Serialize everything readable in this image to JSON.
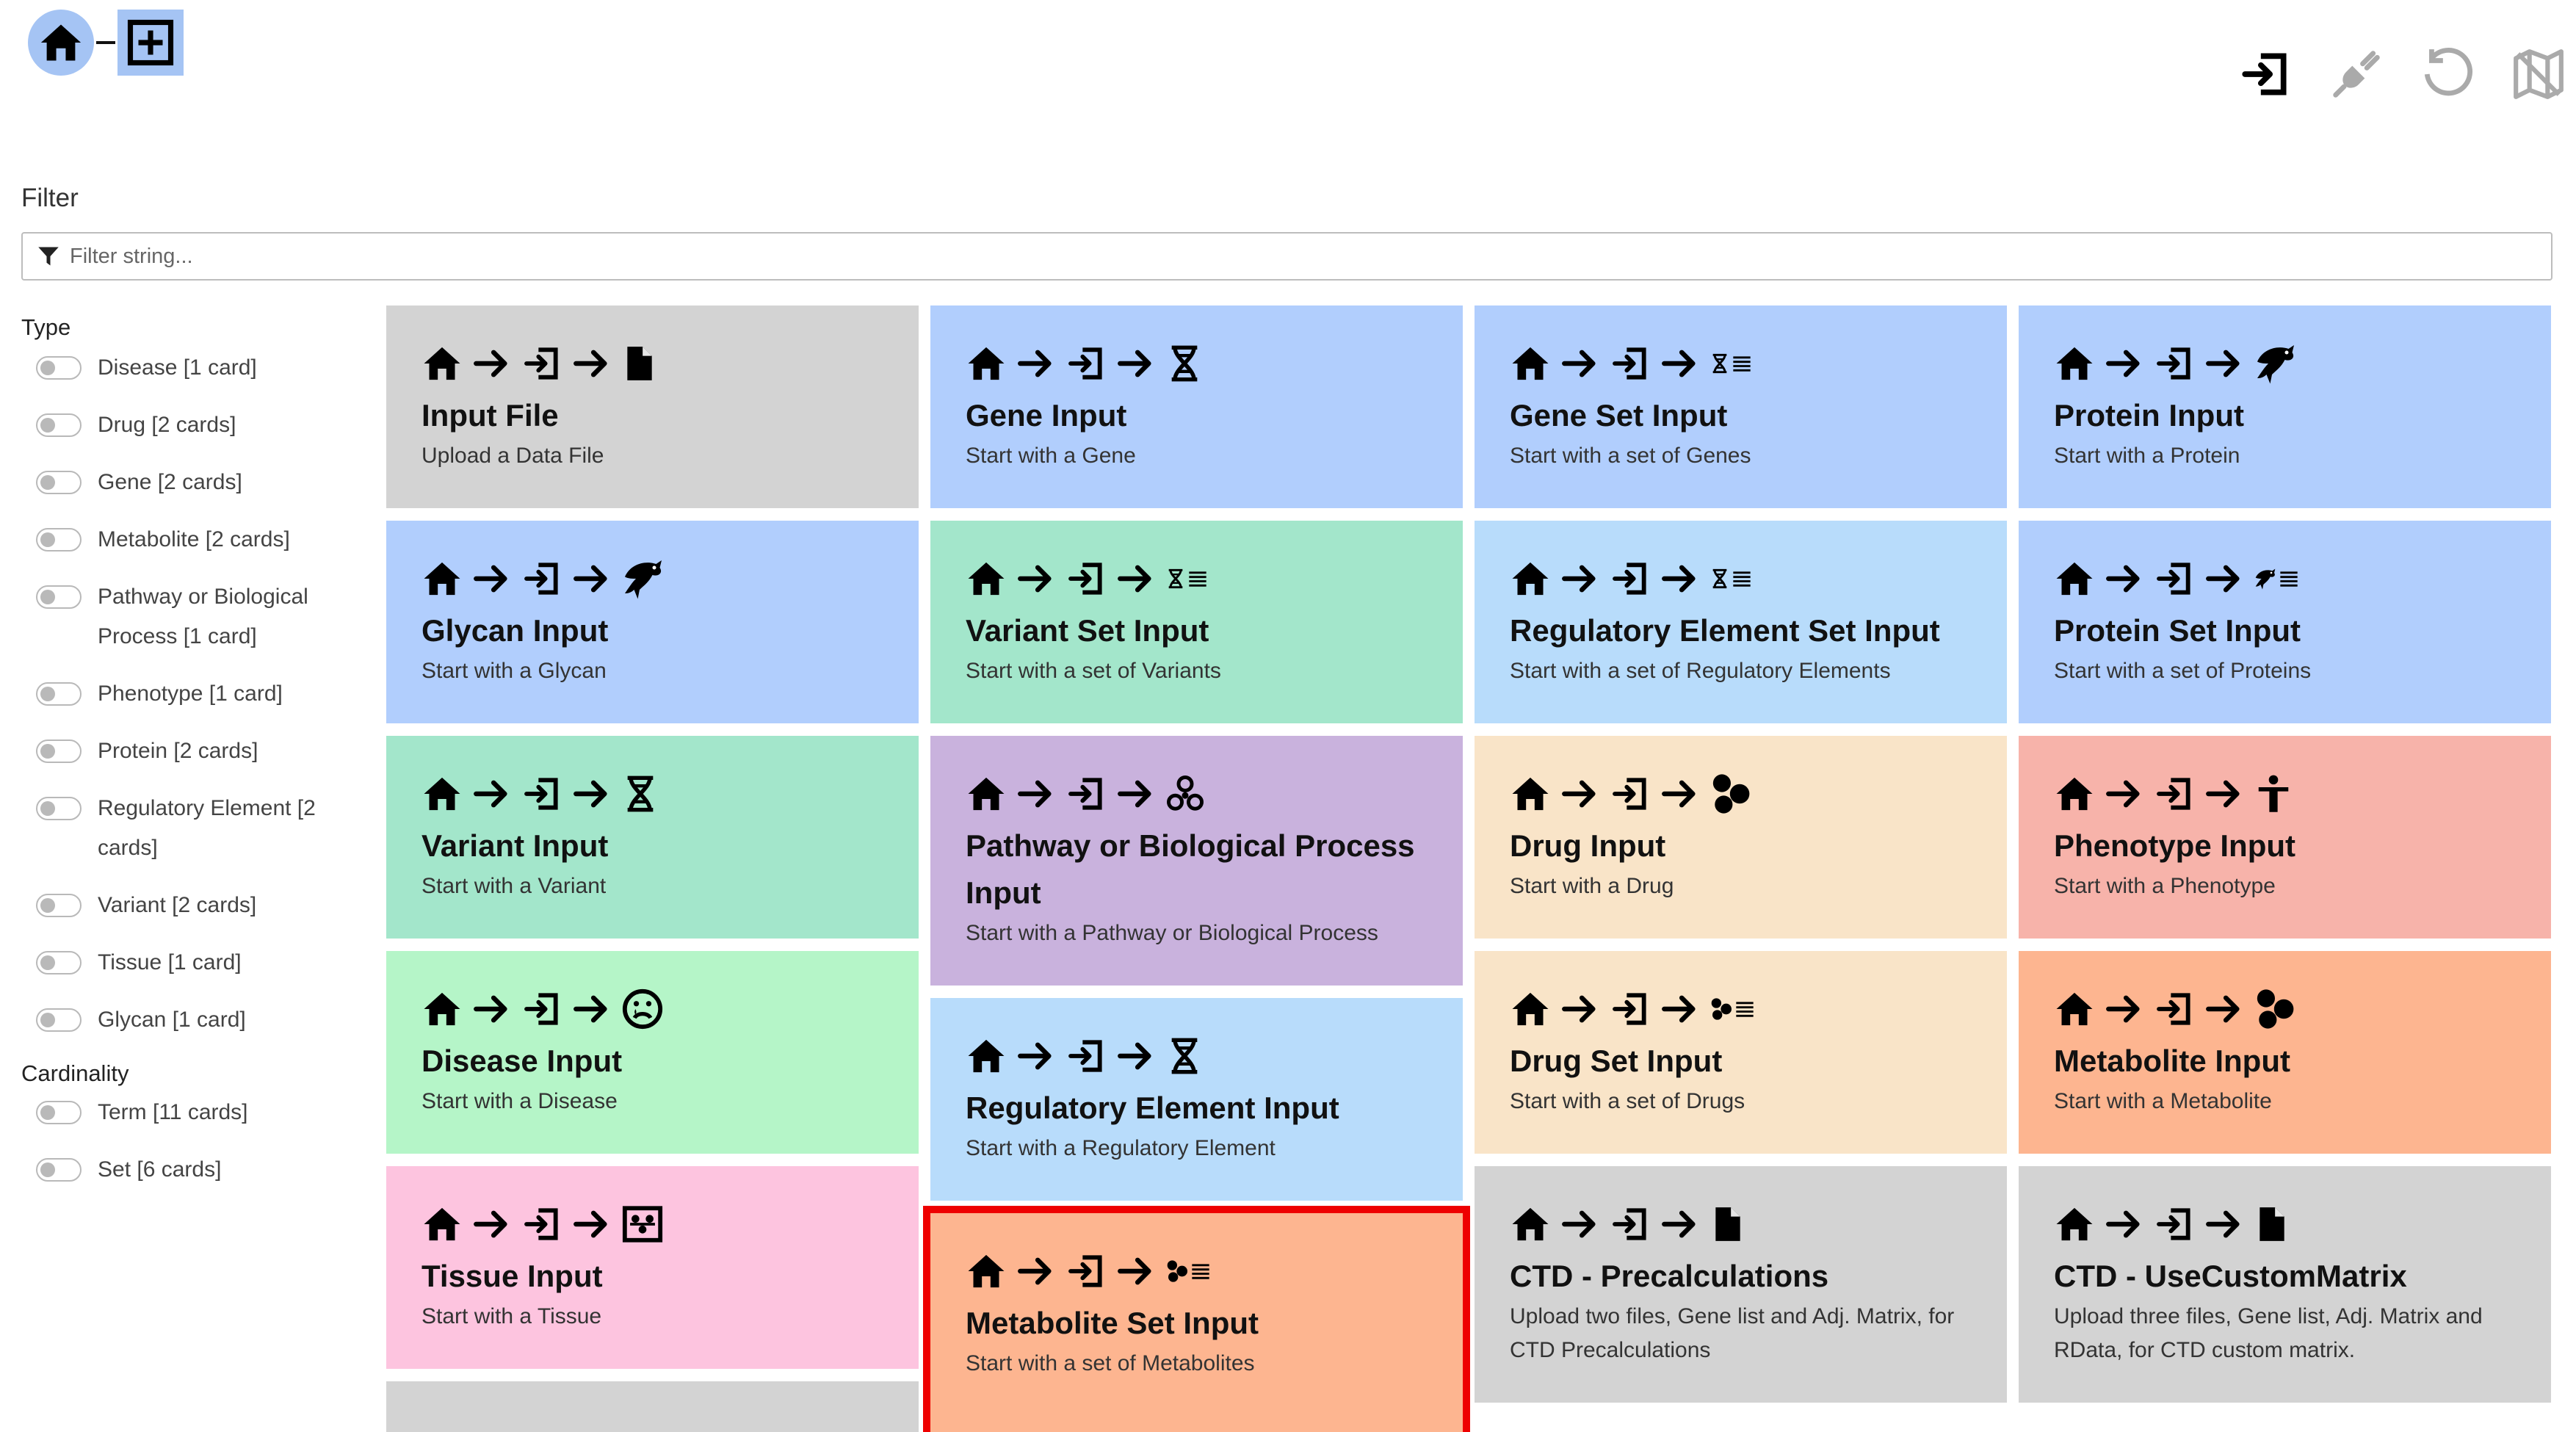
{
  "breadcrumb": {
    "home_icon": "home-icon",
    "add_icon": "plus-square-icon"
  },
  "toolbar": {
    "icons": [
      "import-icon",
      "disconnect-plug-icon",
      "reset-icon",
      "map-icon"
    ]
  },
  "filter": {
    "label": "Filter",
    "placeholder": "Filter string...",
    "value": ""
  },
  "sidebar": {
    "type_title": "Type",
    "type_items": [
      {
        "label": "Disease [1 card]"
      },
      {
        "label": "Drug [2 cards]"
      },
      {
        "label": "Gene [2 cards]"
      },
      {
        "label": "Metabolite [2 cards]"
      },
      {
        "label": "Pathway or Biological Process [1 card]"
      },
      {
        "label": "Phenotype [1 card]"
      },
      {
        "label": "Protein [2 cards]"
      },
      {
        "label": "Regulatory Element [2 cards]"
      },
      {
        "label": "Variant [2 cards]"
      },
      {
        "label": "Tissue [1 card]"
      },
      {
        "label": "Glycan [1 card]"
      }
    ],
    "cardinality_title": "Cardinality",
    "cardinality_items": [
      {
        "label": "Term [11 cards]"
      },
      {
        "label": "Set [6 cards]"
      }
    ]
  },
  "cards": [
    {
      "title": "Input File",
      "subtitle": "Upload a Data File",
      "icon": "file-icon",
      "color": "#d3d3d3"
    },
    {
      "title": "Gene Input",
      "subtitle": "Start with a Gene",
      "icon": "hourglass-dna-icon",
      "color": "#b1cefd"
    },
    {
      "title": "Gene Set Input",
      "subtitle": "Start with a set of Genes",
      "icon": "gene-set-icon",
      "color": "#b1cefd"
    },
    {
      "title": "Protein Input",
      "subtitle": "Start with a Protein",
      "icon": "dolphin-icon",
      "color": "#b1cefd"
    },
    {
      "title": "Glycan Input",
      "subtitle": "Start with a Glycan",
      "icon": "dolphin-icon",
      "color": "#b1cefd"
    },
    {
      "title": "Variant Set Input",
      "subtitle": "Start with a set of Variants",
      "icon": "variant-set-icon",
      "color": "#a3e6cb"
    },
    {
      "title": "Regulatory Element Set Input",
      "subtitle": "Start with a set of Regulatory Elements",
      "icon": "regulatory-set-icon",
      "color": "#b8dcfb"
    },
    {
      "title": "Protein Set Input",
      "subtitle": "Start with a set of Proteins",
      "icon": "protein-set-icon",
      "color": "#b1cefd"
    },
    {
      "title": "Variant Input",
      "subtitle": "Start with a Variant",
      "icon": "hourglass-dna-icon",
      "color": "#a3e6cb"
    },
    {
      "title": "Pathway or Biological Process Input",
      "subtitle": "Start with a Pathway or Biological Process",
      "icon": "biohazard-network-icon",
      "color": "#c9b2dd"
    },
    {
      "title": "Drug Input",
      "subtitle": "Start with a Drug",
      "icon": "molecule-icon",
      "color": "#f9e4c8"
    },
    {
      "title": "Phenotype Input",
      "subtitle": "Start with a Phenotype",
      "icon": "person-icon",
      "color": "#f7b3aa"
    },
    {
      "title": "Disease Input",
      "subtitle": "Start with a Disease",
      "icon": "sad-face-icon",
      "color": "#b5f5c8"
    },
    {
      "title": "Regulatory Element Input",
      "subtitle": "Start with a Regulatory Element",
      "icon": "hourglass-dna-icon",
      "color": "#b8dcfb"
    },
    {
      "title": "Drug Set Input",
      "subtitle": "Start with a set of Drugs",
      "icon": "molecule-set-icon",
      "color": "#f9e4c8"
    },
    {
      "title": "Metabolite Input",
      "subtitle": "Start with a Metabolite",
      "icon": "molecule-icon",
      "color": "#fdb590"
    },
    {
      "title": "Tissue Input",
      "subtitle": "Start with a Tissue",
      "icon": "tissue-icon",
      "color": "#fdc4df"
    },
    {
      "title": "Metabolite Set Input",
      "subtitle": "Start with a set of Metabolites",
      "icon": "molecule-set-icon",
      "color": "#fdb590",
      "selected": true
    },
    {
      "title": "CTD - Precalculations",
      "subtitle": "Upload two files, Gene list and Adj. Matrix, for CTD Precalculations",
      "icon": "file-icon",
      "color": "#d3d3d3"
    },
    {
      "title": "CTD - UseCustomMatrix",
      "subtitle": "Upload three files, Gene list, Adj. Matrix and RData, for CTD custom matrix.",
      "icon": "file-icon",
      "color": "#d3d3d3"
    },
    {
      "title": "",
      "subtitle": "",
      "icon": "",
      "color": "#d3d3d3"
    }
  ]
}
